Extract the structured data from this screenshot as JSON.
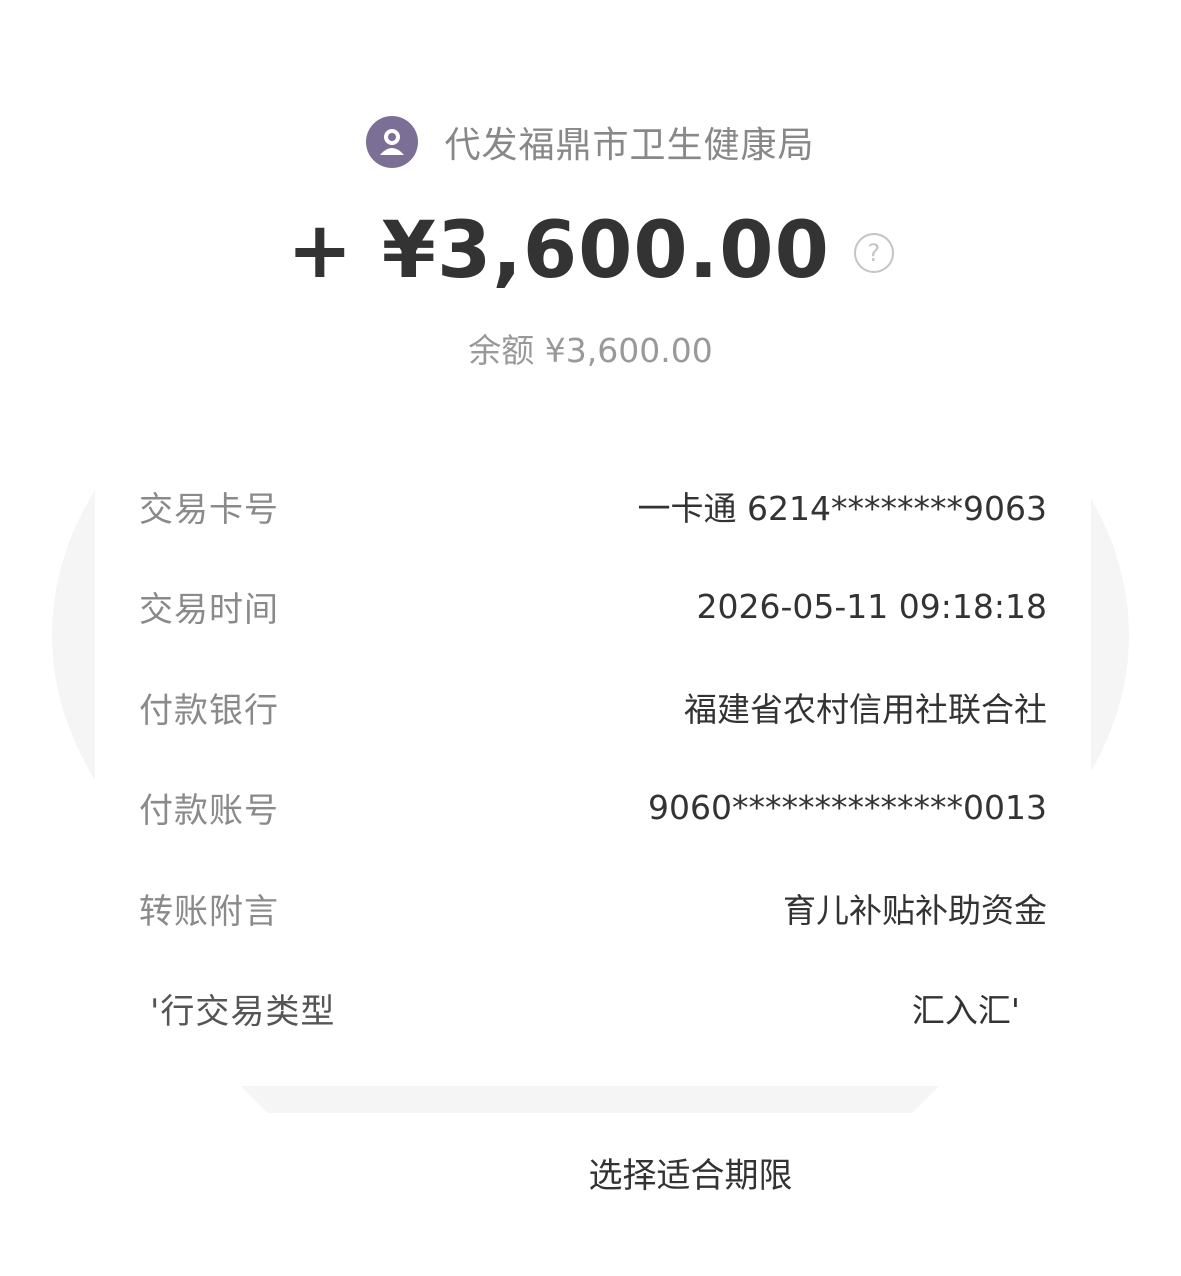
{
  "header": {
    "payer_name": "代发福鼎市卫生健康局",
    "avatar_icon": "person-avatar-icon",
    "amount": "+ ¥3,600.00",
    "help_icon_glyph": "?",
    "balance": "余额 ¥3,600.00"
  },
  "details": [
    {
      "label": "交易卡号",
      "value": "一卡通 6214********9063"
    },
    {
      "label": "交易时间",
      "value": "2026-05-11 09:18:18"
    },
    {
      "label": "付款银行",
      "value": "福建省农村信用社联合社"
    },
    {
      "label": "付款账号",
      "value": "9060**************0013"
    },
    {
      "label": "转账附言",
      "value": "育儿补贴补助资金"
    },
    {
      "label": "'行交易类型",
      "value": "汇入汇'"
    }
  ],
  "footer": {
    "link_text": "选择适合期限"
  },
  "colors": {
    "avatar_bg": "#7b6f96",
    "label_gray": "#8a8a8a",
    "text_dark": "#333333"
  }
}
